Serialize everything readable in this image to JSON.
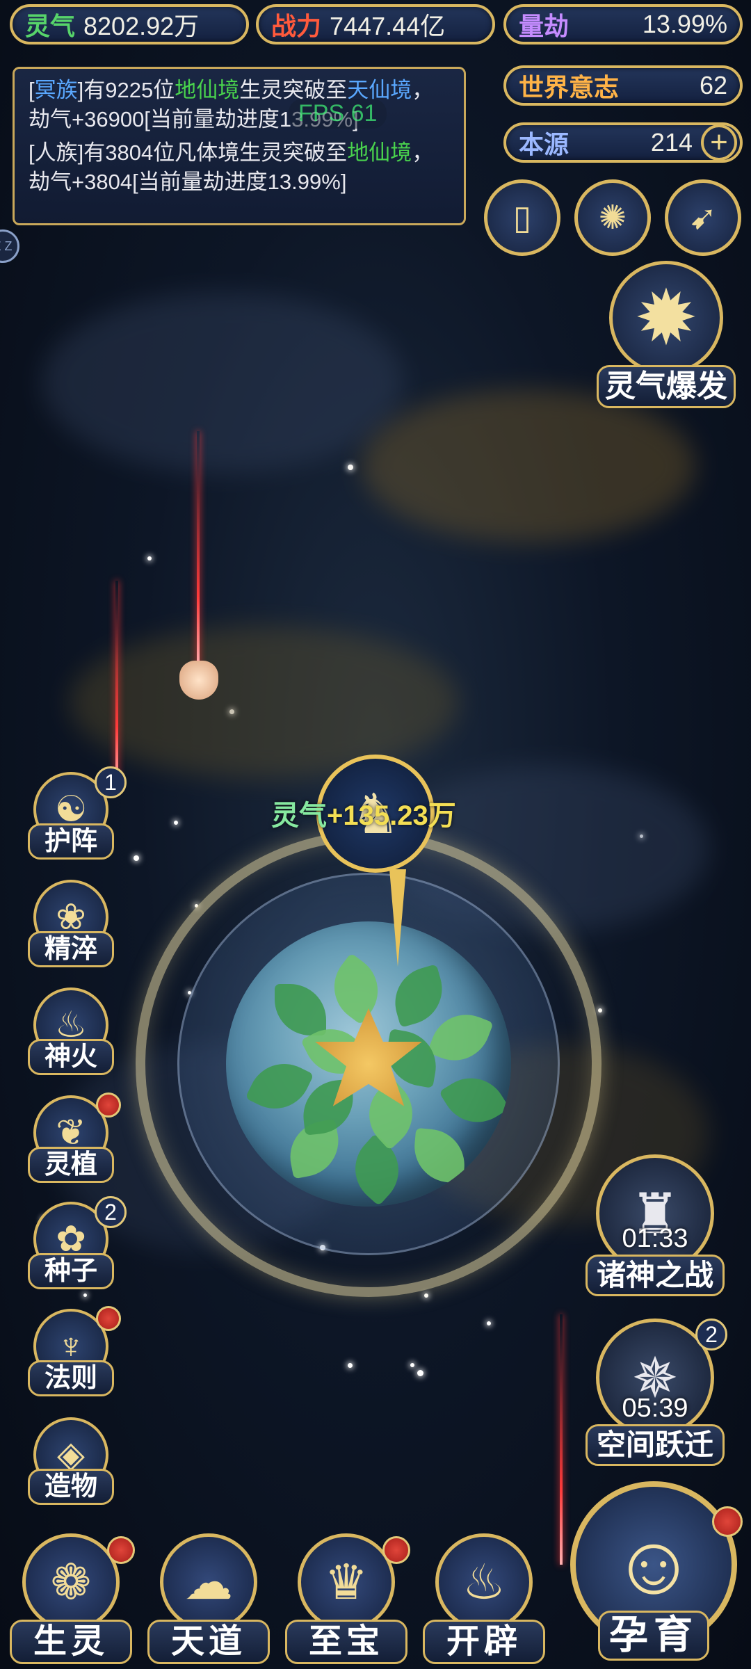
{
  "top_stats": {
    "lingqi": {
      "label": "灵气",
      "value": "8202.92万",
      "label_color": "#57d46a"
    },
    "zhanli": {
      "label": "战力",
      "value": "7447.44亿",
      "label_color": "#ff5a3c"
    },
    "liangjie": {
      "label": "量劫",
      "value": "13.99%",
      "label_color": "#c58cff"
    },
    "shijie_yizhi": {
      "label": "世界意志",
      "value": "62",
      "label_color": "#ffb347"
    },
    "benyuan": {
      "label": "本源",
      "value": "214",
      "label_color": "#9bb8ff"
    },
    "benyuan_plus_symbol": "+"
  },
  "event_log": [
    {
      "segments": [
        {
          "text": "[",
          "color": "#e8e8ee"
        },
        {
          "text": "冥族",
          "color": "#5aa8ff"
        },
        {
          "text": "]有9225位",
          "color": "#e8e8ee"
        },
        {
          "text": "地仙境",
          "color": "#49d24d"
        },
        {
          "text": "生灵突破至",
          "color": "#e8e8ee"
        },
        {
          "text": "天仙境",
          "color": "#5aa8ff"
        },
        {
          "text": "，劫气+36900[当前量劫进度13.99%]",
          "color": "#e8e8ee"
        }
      ]
    },
    {
      "segments": [
        {
          "text": "[人族]有3804位凡体境生灵突破至",
          "color": "#e8e8ee"
        },
        {
          "text": "地仙境",
          "color": "#49d24d"
        },
        {
          "text": "，劫气+3804[当前量劫进度13.99%]",
          "color": "#e8e8ee"
        }
      ]
    }
  ],
  "overlay_text": "FPS 61",
  "top_icons": [
    {
      "name": "card-icon",
      "glyph": "▯"
    },
    {
      "name": "vortex-icon",
      "glyph": "✺"
    },
    {
      "name": "scroll-icon",
      "glyph": "➹"
    }
  ],
  "burst": {
    "label": "灵气爆发",
    "glyph": "✹"
  },
  "gain_popup": {
    "label": "灵气",
    "value": "+135.23万"
  },
  "side_menu": [
    {
      "label": "护阵",
      "glyph": "☯",
      "badge": "1",
      "dot": false
    },
    {
      "label": "精淬",
      "glyph": "❀",
      "badge": "",
      "dot": false
    },
    {
      "label": "神火",
      "glyph": "♨",
      "badge": "",
      "dot": false
    },
    {
      "label": "灵植",
      "glyph": "❦",
      "badge": "",
      "dot": true
    },
    {
      "label": "种子",
      "glyph": "✿",
      "badge": "2",
      "dot": false
    },
    {
      "label": "法则",
      "glyph": "♆",
      "badge": "",
      "dot": true
    },
    {
      "label": "造物",
      "glyph": "◈",
      "badge": "",
      "dot": false
    }
  ],
  "boss_marker_glyph": "♞",
  "zhushen": {
    "label": "诸神之战",
    "time": "01:33",
    "glyph": "♜"
  },
  "kongjian": {
    "label": "空间跃迁",
    "time": "05:39",
    "badge": "2",
    "glyph": "✵"
  },
  "bottom_nav": [
    {
      "label": "生灵",
      "glyph": "❁",
      "dot": true
    },
    {
      "label": "天道",
      "glyph": "☁",
      "dot": false
    },
    {
      "label": "至宝",
      "glyph": "♛",
      "dot": true
    },
    {
      "label": "开辟",
      "glyph": "♨",
      "dot": false
    }
  ],
  "yunyu": {
    "label": "孕育",
    "glyph": "☺",
    "dot": true
  },
  "edge_button_text": "Z Z"
}
